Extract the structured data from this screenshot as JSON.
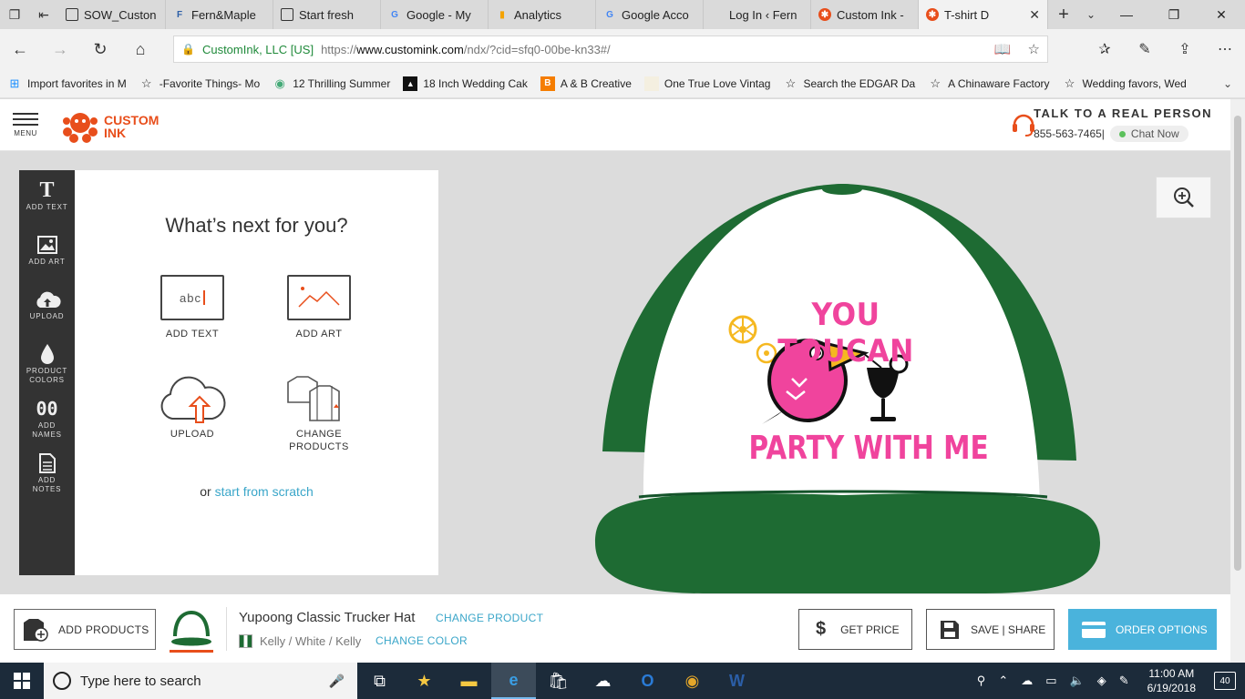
{
  "browser": {
    "tabs": [
      {
        "title": "SOW_Custon",
        "icon": "document-icon"
      },
      {
        "title": "Fern&Maple",
        "icon": "fern-maple-icon"
      },
      {
        "title": "Start fresh",
        "icon": "document-icon"
      },
      {
        "title": "Google - My",
        "icon": "google-icon"
      },
      {
        "title": "Analytics",
        "icon": "analytics-icon"
      },
      {
        "title": "Google Acco",
        "icon": "google-icon"
      },
      {
        "title": "Log In ‹ Fern",
        "icon": "blank-icon"
      },
      {
        "title": "Custom Ink -",
        "icon": "customink-icon"
      },
      {
        "title": "T-shirt D",
        "icon": "customink-icon",
        "active": true
      }
    ],
    "address": {
      "org": "CustomInk, LLC [US]",
      "scheme": "https://",
      "host": "www.customink.com",
      "path": "/ndx/?cid=sfq0-00be-kn33#/"
    },
    "favorites": [
      {
        "label": "Import favorites in M",
        "icon": "windows-icon"
      },
      {
        "label": "-Favorite Things- Mo",
        "icon": "star-icon"
      },
      {
        "label": "12 Thrilling Summer",
        "icon": "site-icon"
      },
      {
        "label": "18 Inch Wedding Cak",
        "icon": "site-icon"
      },
      {
        "label": "A & B Creative",
        "icon": "blogger-icon"
      },
      {
        "label": "One True Love Vintag",
        "icon": "page-icon"
      },
      {
        "label": "Search the EDGAR Da",
        "icon": "star-icon"
      },
      {
        "label": "A Chinaware Factory",
        "icon": "star-icon"
      },
      {
        "label": "Wedding favors, Wed",
        "icon": "star-icon"
      }
    ]
  },
  "site": {
    "menu_label": "MENU",
    "logo_line1": "CUSTOM",
    "logo_line2": "INK",
    "contact_title": "TALK TO A REAL PERSON",
    "phone": "855-563-7465",
    "chat_label": "Chat Now"
  },
  "tools": [
    {
      "label": "ADD TEXT",
      "icon": "text-icon"
    },
    {
      "label": "ADD ART",
      "icon": "image-icon"
    },
    {
      "label": "UPLOAD",
      "icon": "cloud-upload-icon"
    },
    {
      "label": "PRODUCT COLORS",
      "icon": "droplet-icon"
    },
    {
      "label": "ADD NAMES",
      "icon": "jersey-number-icon"
    },
    {
      "label": "ADD NOTES",
      "icon": "note-icon"
    }
  ],
  "panel": {
    "title": "What’s next for you?",
    "options": [
      {
        "label": "ADD TEXT"
      },
      {
        "label": "ADD ART"
      },
      {
        "label": "UPLOAD"
      },
      {
        "label": "CHANGE PRODUCTS"
      }
    ],
    "scratch_prefix": "or ",
    "scratch_link": "start from scratch"
  },
  "design": {
    "line1": "YOU TOUCAN",
    "line2": "PARTY WITH ME",
    "text_color": "#f0449d",
    "hat_color": "#1e6b33"
  },
  "bottom": {
    "add_products": "ADD PRODUCTS",
    "product_name": "Yupoong Classic Trucker Hat",
    "change_product": "CHANGE PRODUCT",
    "color_name": "Kelly / White / Kelly",
    "change_color": "CHANGE COLOR",
    "get_price": "GET PRICE",
    "save_share": "SAVE | SHARE",
    "order_options": "ORDER OPTIONS"
  },
  "taskbar": {
    "search_placeholder": "Type here to search",
    "time": "11:00 AM",
    "date": "6/19/2018",
    "notification_count": "40"
  },
  "colors": {
    "brand_orange": "#e84e1b",
    "link_blue": "#3aa6c9",
    "order_blue": "#4ab3dc"
  }
}
